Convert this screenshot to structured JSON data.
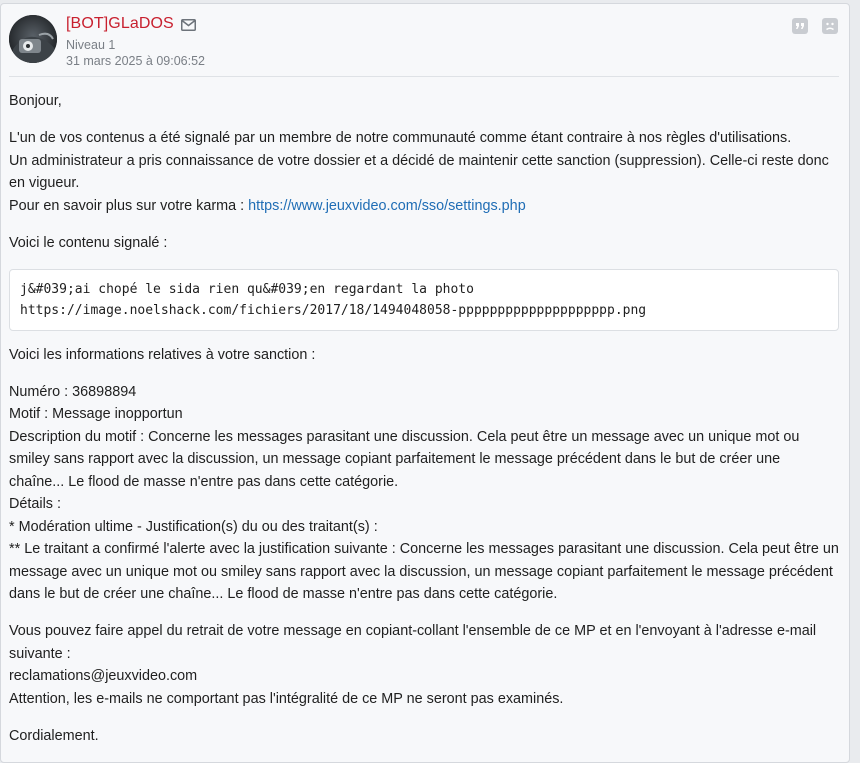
{
  "author": {
    "name": "[BOT]GLaDOS",
    "level": "Niveau 1",
    "date": "31 mars 2025 à 09:06:52"
  },
  "icons": {
    "mail": "envelope-icon",
    "quote": "quote-icon",
    "report": "report-icon"
  },
  "colors": {
    "author_name": "#c8202f",
    "link": "#1f6db5",
    "meta": "#7a7f86"
  },
  "message": {
    "greeting": "Bonjour,",
    "intro_1": "L'un de vos contenus a été signalé par un membre de notre communauté comme étant contraire à nos règles d'utilisations.",
    "intro_2": "Un administrateur a pris connaissance de votre dossier et a décidé de maintenir cette sanction (suppression). Celle-ci reste donc en vigueur.",
    "karma_text": "Pour en savoir plus sur votre karma : ",
    "karma_link": "https://www.jeuxvideo.com/sso/settings.php",
    "reported_title": "Voici le contenu signalé :",
    "reported_line_1": "j&#039;ai chopé le sida rien qu&#039;en regardant la photo",
    "reported_line_2": "https://image.noelshack.com/fichiers/2017/18/1494048058-pppppppppppppppppppp.png",
    "sanction_title": "Voici les informations relatives à votre sanction :",
    "numero": "Numéro : 36898894",
    "motif": "Motif : Message inopportun",
    "description": "Description du motif : Concerne les messages parasitant une discussion. Cela peut être un message avec un unique mot ou smiley sans rapport avec la discussion, un message copiant parfaitement le message précédent dans le but de créer une chaîne... Le flood de masse n'entre pas dans cette catégorie.",
    "details": "Détails :",
    "moderation": "* Modération ultime - Justification(s) du ou des traitant(s) :",
    "traitant": "** Le traitant a confirmé l'alerte avec la justification suivante : Concerne les messages parasitant une discussion. Cela peut être un message avec un unique mot ou smiley sans rapport avec la discussion, un message copiant parfaitement le message précédent dans le but de créer une chaîne... Le flood de masse n'entre pas dans cette catégorie.",
    "appeal": "Vous pouvez faire appel du retrait de votre message en copiant-collant l'ensemble de ce MP et en l'envoyant à l'adresse e-mail suivante :",
    "email": "reclamations@jeuxvideo.com",
    "warning": "Attention, les e-mails ne comportant pas l'intégralité de ce MP ne seront pas examinés.",
    "closing": "Cordialement."
  }
}
